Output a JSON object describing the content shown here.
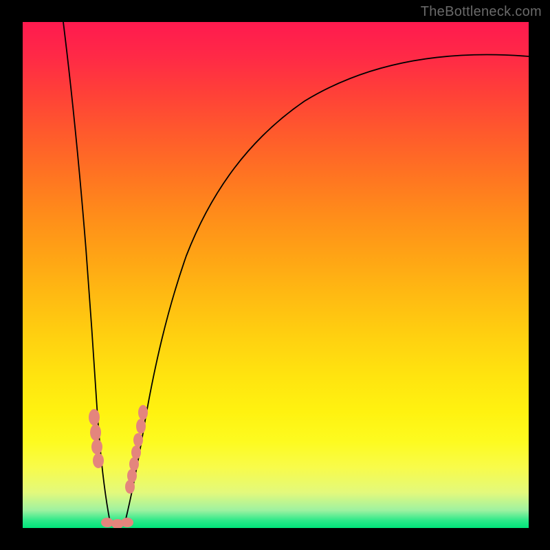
{
  "watermark": "TheBottleneck.com",
  "colors": {
    "marker": "#e4857d",
    "curve": "#000000",
    "frame": "#000000"
  },
  "chart_data": {
    "type": "line",
    "title": "",
    "xlabel": "",
    "ylabel": "",
    "xlim": [
      0,
      100
    ],
    "ylim": [
      0,
      100
    ],
    "grid": false,
    "legend": false,
    "note": "V-shaped bottleneck curve with minimum near x≈17; y represents bottleneck percentage (0% = green bottom, 100% = red top). Values estimated from pixel position.",
    "series": [
      {
        "name": "bottleneck_curve",
        "x": [
          8,
          10,
          12,
          13,
          14,
          15,
          16,
          17,
          18,
          19,
          20,
          21,
          22,
          23,
          25,
          28,
          32,
          38,
          45,
          55,
          68,
          82,
          100
        ],
        "y": [
          100,
          82,
          58,
          44,
          31,
          20,
          10,
          3,
          0,
          3,
          9,
          16,
          24,
          31,
          43,
          55,
          65,
          74,
          80,
          85,
          89,
          91.5,
          93
        ]
      }
    ],
    "markers": {
      "name": "highlighted_points",
      "note": "Salmon-colored dots/ovals clustered around the curve minimum on both branches and at the bottom.",
      "x": [
        13.3,
        13.6,
        13.9,
        14.1,
        16.5,
        17.5,
        18.5,
        19.5,
        20.7,
        21.0,
        21.2,
        21.4,
        21.6,
        22.0,
        22.3
      ],
      "y": [
        21,
        18,
        15,
        12,
        0,
        0,
        0,
        0,
        8,
        10,
        12,
        14,
        16,
        19,
        21
      ]
    }
  }
}
